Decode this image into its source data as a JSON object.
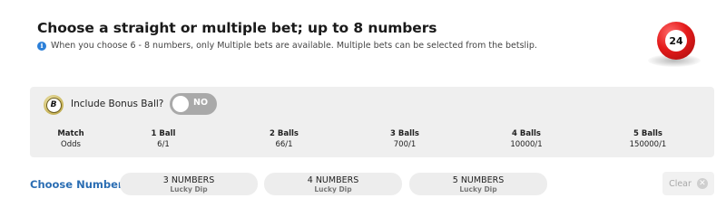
{
  "header": {
    "title": "Choose a straight or multiple bet; up to 8 numbers",
    "info_icon": "info-icon",
    "info_text": "When you choose 6 - 8 numbers, only Multiple bets are available. Multiple bets can be selected from the betslip.",
    "ball_number": "24",
    "ball_color": "#e41b1b"
  },
  "bonus": {
    "badge_letter": "B",
    "label": "Include Bonus Ball?",
    "toggle_state": "NO"
  },
  "odds": [
    {
      "heading": "Match",
      "value": "Odds"
    },
    {
      "heading": "1 Ball",
      "value": "6/1"
    },
    {
      "heading": "2 Balls",
      "value": "66/1"
    },
    {
      "heading": "3 Balls",
      "value": "700/1"
    },
    {
      "heading": "4 Balls",
      "value": "10000/1"
    },
    {
      "heading": "5 Balls",
      "value": "150000/1"
    }
  ],
  "choose": {
    "label": "Choose Numbers",
    "options": [
      {
        "title": "3 NUMBERS",
        "subtitle": "Lucky Dip"
      },
      {
        "title": "4 NUMBERS",
        "subtitle": "Lucky Dip"
      },
      {
        "title": "5 NUMBERS",
        "subtitle": "Lucky Dip"
      }
    ],
    "clear_label": "Clear",
    "clear_icon": "close-icon"
  },
  "colors": {
    "accent": "#2a6db3",
    "panel_bg": "#efefef",
    "toggle_bg": "#a9a9a9"
  }
}
